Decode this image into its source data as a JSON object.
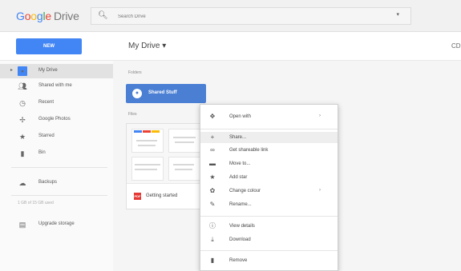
{
  "header": {
    "logo_letters": [
      "G",
      "o",
      "o",
      "g",
      "l",
      "e"
    ],
    "logo_product": "Drive",
    "search": {
      "placeholder": "Search Drive",
      "value": ""
    },
    "right_label": "CD"
  },
  "toolbar": {
    "new_label": "NEW",
    "location_title": "My Drive ▾"
  },
  "sidebar": {
    "items": [
      {
        "label": "My Drive",
        "icon": "folder-icon"
      },
      {
        "label": "Shared with me",
        "icon": "people-icon"
      },
      {
        "label": "Recent",
        "icon": "clock-icon"
      },
      {
        "label": "Google Photos",
        "icon": "pinwheel-icon"
      },
      {
        "label": "Starred",
        "icon": "star-icon"
      },
      {
        "label": "Bin",
        "icon": "trash-icon"
      },
      {
        "label": "Backups",
        "icon": "cloud-icon"
      },
      {
        "label": "Upgrade storage",
        "icon": "storage-icon"
      }
    ],
    "storage_text": "1 GB of 15 GB used"
  },
  "main": {
    "folders_label": "Folders",
    "folder_name": "Shared Stuff",
    "files_label": "Files",
    "file_name": "Getting started",
    "file_type_badge": "PDF"
  },
  "context_menu": {
    "items": [
      {
        "label": "Open with",
        "icon": "move-icon",
        "submenu": true
      },
      {
        "label": "Share...",
        "icon": "add-person-icon"
      },
      {
        "label": "Get shareable link",
        "icon": "link-icon"
      },
      {
        "label": "Move to...",
        "icon": "folder-move-icon"
      },
      {
        "label": "Add star",
        "icon": "star-icon"
      },
      {
        "label": "Change colour",
        "icon": "palette-icon",
        "submenu": true
      },
      {
        "label": "Rename...",
        "icon": "pencil-icon"
      },
      {
        "label": "View details",
        "icon": "info-icon"
      },
      {
        "label": "Download",
        "icon": "download-icon"
      },
      {
        "label": "Remove",
        "icon": "trash-icon"
      }
    ],
    "submenu_arrow": "›"
  },
  "colors": {
    "accent": "#4285f4",
    "folder": "#4a7fd4",
    "pdf": "#e53935"
  }
}
